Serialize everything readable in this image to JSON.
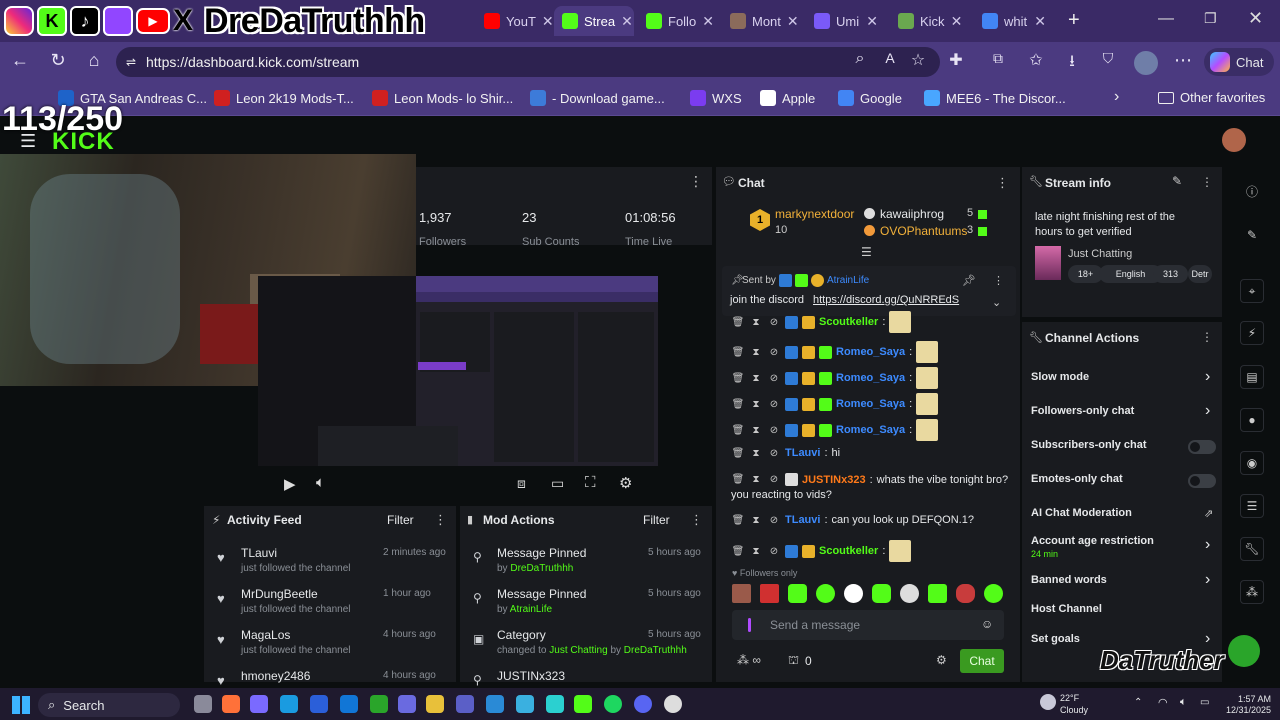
{
  "overlay": {
    "social_name": "DreDaTruthhh",
    "counter": "113/250",
    "watermark": "DaTruther"
  },
  "tabs": [
    {
      "label": "YouT",
      "color": "#ff0000"
    },
    {
      "label": "Strea",
      "color": "#53fc18"
    },
    {
      "label": "Follo",
      "color": "#53fc18"
    },
    {
      "label": "Mont",
      "color": "#8b6b5b"
    },
    {
      "label": "Umi",
      "color": "#7a5af8"
    },
    {
      "label": "Kick",
      "color": "#6aa84f"
    },
    {
      "label": "whit",
      "color": "#4285f4"
    }
  ],
  "address": {
    "url": "https://dashboard.kick.com/stream",
    "copilot_label": "Chat"
  },
  "bookmarks": [
    {
      "label": "GTA San Andreas C...",
      "color": "#1e63c9"
    },
    {
      "label": "Leon 2k19 Mods-T...",
      "color": "#d02020"
    },
    {
      "label": "Leon Mods- lo Shir...",
      "color": "#d02020"
    },
    {
      "label": "- Download game...",
      "color": "#3d7bd9"
    },
    {
      "label": "WXS",
      "color": "#7b3cf0"
    },
    {
      "label": "Apple",
      "color": "#ffffff"
    },
    {
      "label": "Google",
      "color": "#4285f4"
    },
    {
      "label": "MEE6 - The Discor...",
      "color": "#49a6ff"
    }
  ],
  "other_favorites": "Other favorites",
  "kick_logo": "KICK",
  "stats": {
    "followers_value": "1,937",
    "followers_label": "Followers",
    "subs_value": "23",
    "subs_label": "Sub Counts",
    "time_value": "01:08:56",
    "time_label": "Time Live"
  },
  "activity_feed": {
    "title": "Activity Feed",
    "filter": "Filter",
    "items": [
      {
        "name": "TLauvi",
        "desc": "just followed the channel",
        "time": "2 minutes ago"
      },
      {
        "name": "MrDungBeetle",
        "desc": "just followed the channel",
        "time": "1 hour ago"
      },
      {
        "name": "MagaLos",
        "desc": "just followed the channel",
        "time": "4 hours ago"
      },
      {
        "name": "hmoney2486",
        "desc": "",
        "time": "4 hours ago"
      }
    ]
  },
  "mod_actions": {
    "title": "Mod Actions",
    "filter": "Filter",
    "items": [
      {
        "title": "Message Pinned",
        "by": "by",
        "user": "DreDaTruthhh",
        "time": "5 hours ago"
      },
      {
        "title": "Message Pinned",
        "by": "by",
        "user": "AtrainLife",
        "time": "5 hours ago"
      },
      {
        "title": "Category",
        "changed": "changed to",
        "category": "Just Chatting",
        "by": "by",
        "user": "DreDaTruthhh",
        "time": "5 hours ago"
      },
      {
        "title": "JUSTINx323",
        "time": ""
      }
    ]
  },
  "chat": {
    "title": "Chat",
    "leader": {
      "rank": "1",
      "name": "markynextdoor",
      "count": "10"
    },
    "gifters": [
      {
        "name": "kawaiiphrog",
        "count": "5"
      },
      {
        "name": "OVOPhantuums",
        "count": "3"
      }
    ],
    "pinned": {
      "label": "Sent by",
      "user": "AtrainLife",
      "text": "join the discord",
      "link": "https://discord.gg/QuNRREdS"
    },
    "messages": [
      {
        "user": "Scoutkeller",
        "text": "",
        "color": "#53fc18"
      },
      {
        "user": "Romeo_Saya",
        "text": "",
        "color": "#3d8bff"
      },
      {
        "user": "Romeo_Saya",
        "text": "",
        "color": "#3d8bff"
      },
      {
        "user": "Romeo_Saya",
        "text": "",
        "color": "#3d8bff"
      },
      {
        "user": "Romeo_Saya",
        "text": "",
        "color": "#3d8bff"
      },
      {
        "user": "TLauvi",
        "text": "hi",
        "color": "#3d8bff"
      },
      {
        "user": "JUSTINx323",
        "text": "whats the vibe tonight bro?",
        "text2": "you reacting to vids?",
        "color": "#ff7a1a"
      },
      {
        "user": "TLauvi",
        "text": "can you look up DEFQON.1?",
        "color": "#3d8bff"
      },
      {
        "user": "Scoutkeller",
        "text": "",
        "color": "#53fc18"
      }
    ],
    "mode": "Followers only",
    "input_placeholder": "Send a message",
    "viewers": "0",
    "send_label": "Chat"
  },
  "stream_info": {
    "title": "Stream info",
    "stream_title": "late night finishing rest of the hours to get verified",
    "category": "Just Chatting",
    "tags": [
      "18+",
      "English",
      "313",
      "Detr"
    ]
  },
  "channel_actions": {
    "title": "Channel Actions",
    "items": [
      {
        "label": "Slow mode",
        "control": "chevron"
      },
      {
        "label": "Followers-only chat",
        "control": "chevron"
      },
      {
        "label": "Subscribers-only chat",
        "control": "toggle"
      },
      {
        "label": "Emotes-only chat",
        "control": "toggle"
      },
      {
        "label": "AI Chat Moderation",
        "control": "external"
      },
      {
        "label": "Account age restriction",
        "sub": "24 min",
        "control": "chevron"
      },
      {
        "label": "Banned words",
        "control": "chevron"
      },
      {
        "label": "Host Channel",
        "control": "none"
      },
      {
        "label": "Set goals",
        "control": "chevron"
      }
    ]
  },
  "taskbar": {
    "search": "Search",
    "weather_temp": "22°F",
    "weather_desc": "Cloudy",
    "time": "1:57 AM",
    "date": "12/31/2025"
  },
  "colors": {
    "kick_green": "#53fc18",
    "panel": "#191b1f",
    "browser": "#4b3a80"
  }
}
